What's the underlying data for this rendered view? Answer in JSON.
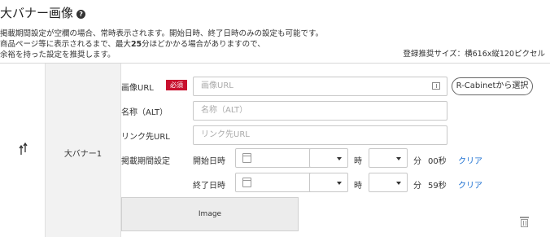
{
  "header": {
    "title": "大バナー画像",
    "help_icon": "question-circle-icon",
    "desc_line1": "掲載期間設定が空欄の場合、常時表示されます。開始日時、終了日時のみの設定も可能です。",
    "desc_line2_pre": "商品ページ等に表示されるまで、最大",
    "desc_line2_bold": "25",
    "desc_line2_post": "分ほどかかる場合がありますので、",
    "desc_line3": "余裕を持った設定を推奨します。",
    "recommended_size": "登録推奨サイズ：横616x縦120ピクセル"
  },
  "row": {
    "sort_icon": "sort-arrows-icon",
    "name": "大バナー1",
    "image_url": {
      "label": "画像URL",
      "required_badge": "必須",
      "placeholder": "画像URL",
      "icon": "image-icon"
    },
    "rcabinet_button": "R-Cabinetから選択",
    "alt": {
      "label": "名称（ALT）",
      "placeholder": "名称（ALT）"
    },
    "link_url": {
      "label": "リンク先URL",
      "placeholder": "リンク先URL"
    },
    "period": {
      "label": "掲載期間設定",
      "start": {
        "label": "開始日時",
        "hour_unit": "時",
        "minute_unit": "分",
        "seconds": "00秒",
        "clear": "クリア"
      },
      "end": {
        "label": "終了日時",
        "hour_unit": "時",
        "minute_unit": "分",
        "seconds": "59秒",
        "clear": "クリア"
      }
    },
    "image_preview_text": "Image",
    "delete_icon": "trash-icon"
  },
  "colors": {
    "required": "#c8102e",
    "link": "#1b6fd1",
    "name_column_bg": "#f2f2f2"
  }
}
